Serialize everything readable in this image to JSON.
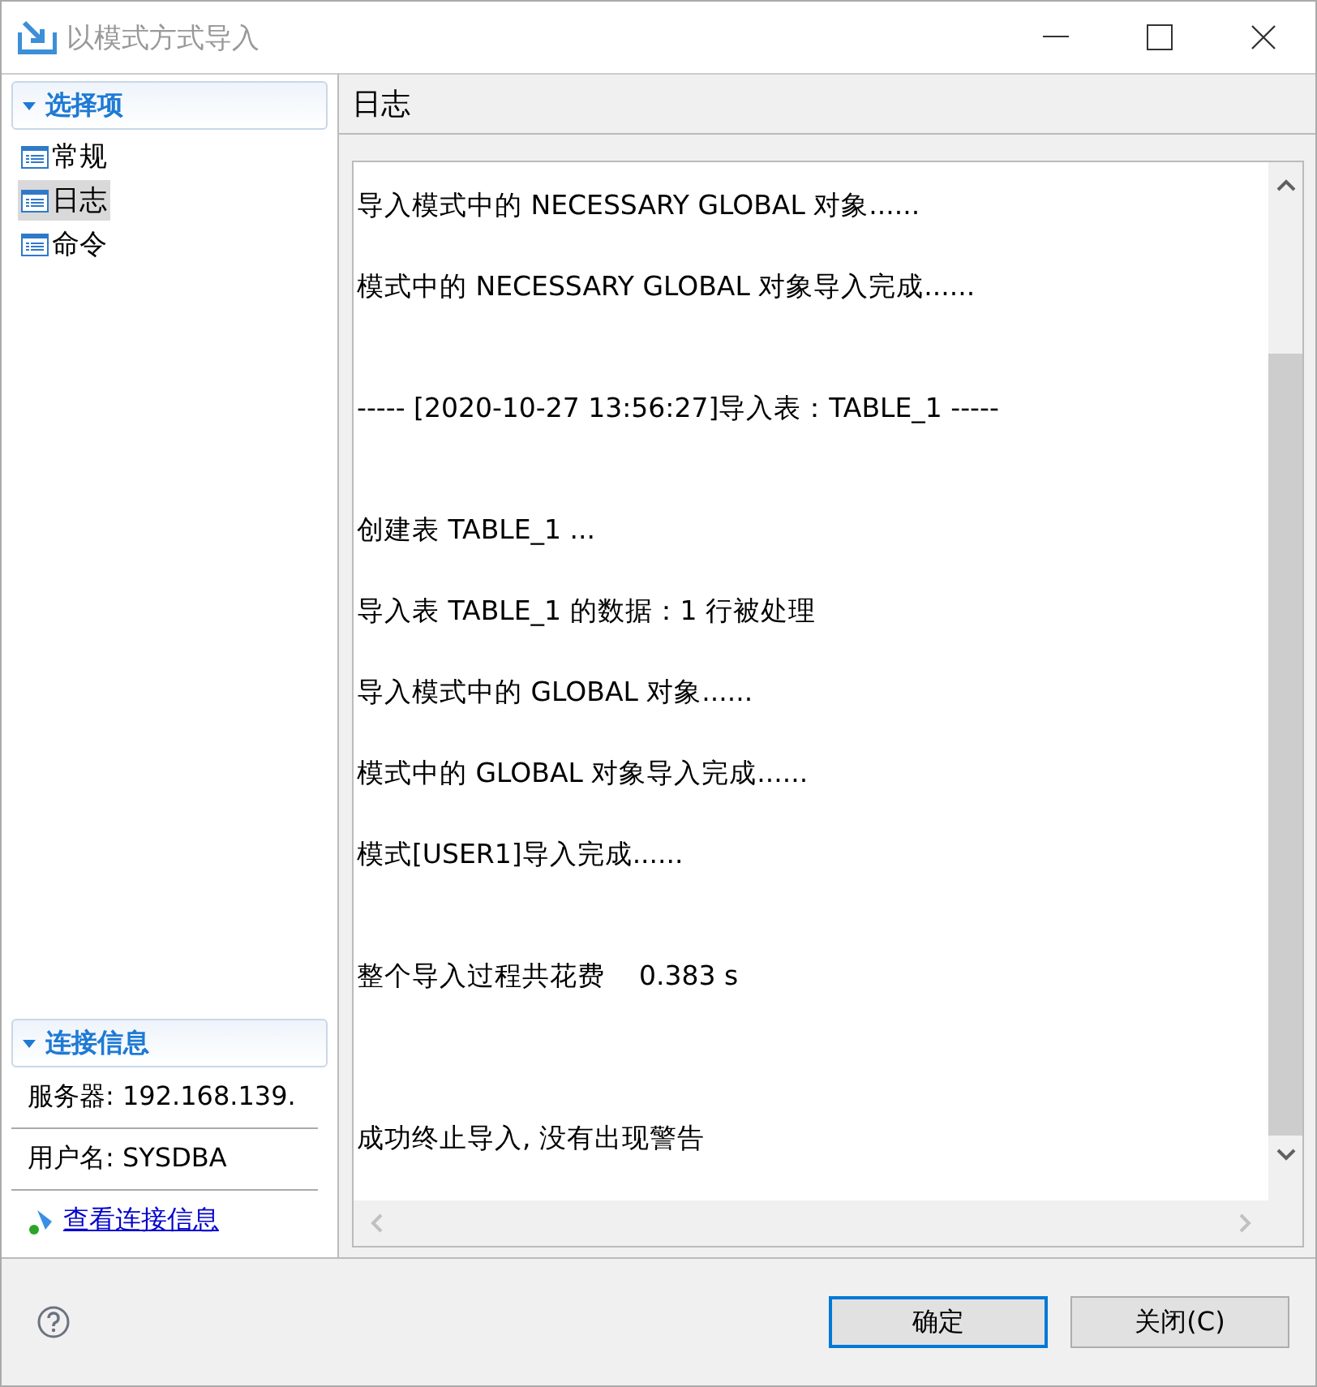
{
  "window": {
    "title": "以模式方式导入"
  },
  "sidebar": {
    "section_title": "选择项",
    "expanded": true,
    "items": [
      {
        "label": "常规",
        "selected": false
      },
      {
        "label": "日志",
        "selected": true
      },
      {
        "label": "命令",
        "selected": false
      }
    ]
  },
  "connection": {
    "section_title": "连接信息",
    "expanded": true,
    "server": "服务器: 192.168.139.",
    "user": "用户名: SYSDBA",
    "link": "查看连接信息"
  },
  "panel": {
    "title": "日志"
  },
  "log": [
    {
      "text": "导入模式中的 NECESSARY GLOBAL 对象......",
      "kind": "normal"
    },
    {
      "text": "模式中的 NECESSARY GLOBAL 对象导入完成......",
      "kind": "normal"
    },
    {
      "text": "----- [2020-10-27 13:56:27]导入表：TABLE_1 -----",
      "kind": "gap"
    },
    {
      "text": "创建表 TABLE_1 ...",
      "kind": "gap"
    },
    {
      "text": "导入表 TABLE_1 的数据：1 行被处理",
      "kind": "normal"
    },
    {
      "text": "导入模式中的 GLOBAL 对象......",
      "kind": "normal"
    },
    {
      "text": "模式中的 GLOBAL 对象导入完成......",
      "kind": "normal"
    },
    {
      "text": "模式[USER1]导入完成......",
      "kind": "normal"
    },
    {
      "text": "整个导入过程共花费    0.383 s",
      "kind": "gap"
    },
    {
      "text": "成功终止导入, 没有出现警告",
      "kind": "long_gap"
    }
  ],
  "buttons": [
    {
      "label": "确定",
      "default": true
    },
    {
      "label": "关闭(C)",
      "default": false
    }
  ]
}
